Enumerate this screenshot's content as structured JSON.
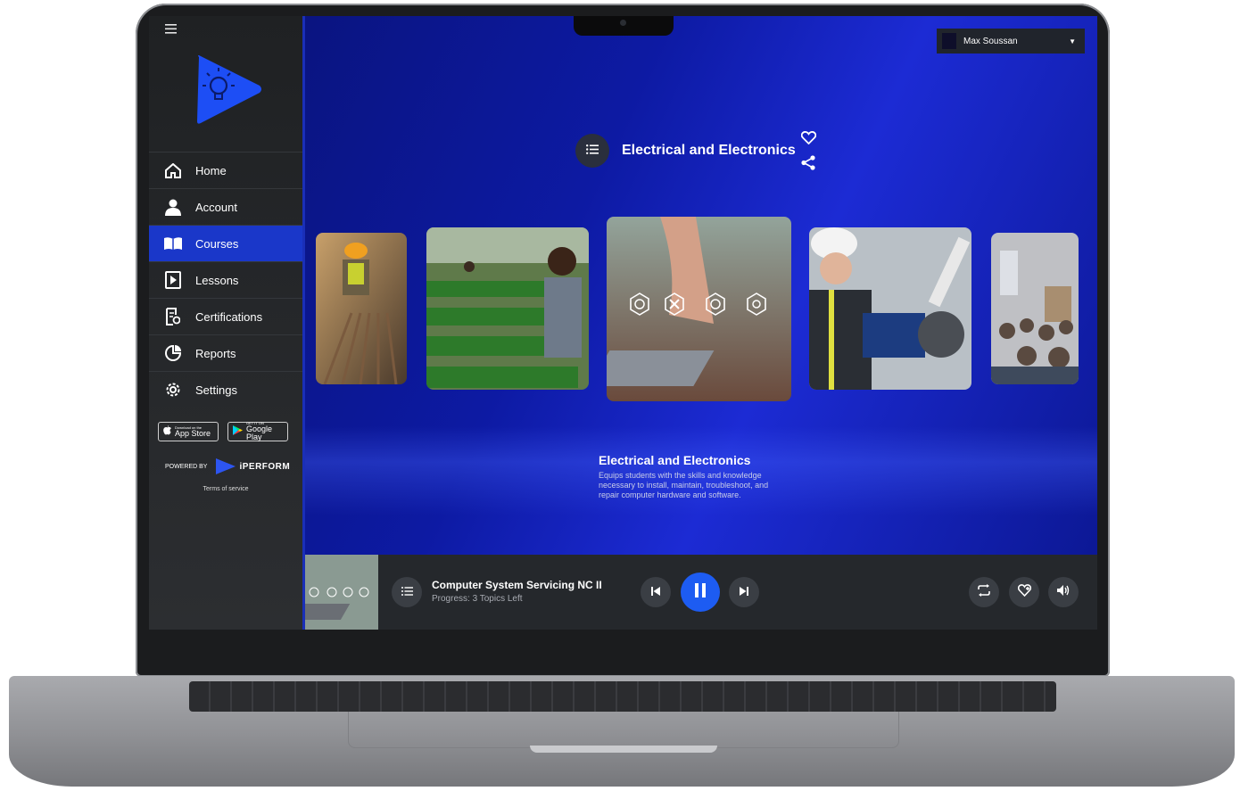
{
  "user": {
    "name": "Max Soussan"
  },
  "nav": {
    "items": [
      {
        "label": "Home"
      },
      {
        "label": "Account"
      },
      {
        "label": "Courses"
      },
      {
        "label": "Lessons"
      },
      {
        "label": "Certifications"
      },
      {
        "label": "Reports"
      },
      {
        "label": "Settings"
      }
    ],
    "active": "Courses"
  },
  "stores": {
    "apple_small": "Download on the",
    "apple_large": "App Store",
    "google_small": "GET IT ON",
    "google_large": "Google Play"
  },
  "footer": {
    "powered_by": "POWERED BY",
    "brand": "iPERFORM",
    "tos": "Terms of service"
  },
  "course": {
    "title": "Electrical and Electronics",
    "description_title": "Electrical and Electronics",
    "description": "Equips students with the skills and knowledge necessary to install, maintain, troubleshoot, and repair computer hardware and software."
  },
  "player": {
    "title": "Computer System Servicing NC II",
    "progress": "Progress: 3 Topics Left"
  },
  "colors": {
    "accent": "#1a37c9",
    "play": "#1d5cf2",
    "background": "#0d1aa3"
  },
  "icons": [
    "menu-icon",
    "home-icon",
    "user-icon",
    "book-icon",
    "play-lesson-icon",
    "certificate-icon",
    "reports-icon",
    "gear-icon",
    "list-icon",
    "heart-icon",
    "share-icon",
    "skip-previous-icon",
    "pause-icon",
    "skip-next-icon",
    "repeat-icon",
    "heart-plus-icon",
    "volume-icon",
    "apple-icon",
    "google-play-icon",
    "chevron-down-icon"
  ]
}
